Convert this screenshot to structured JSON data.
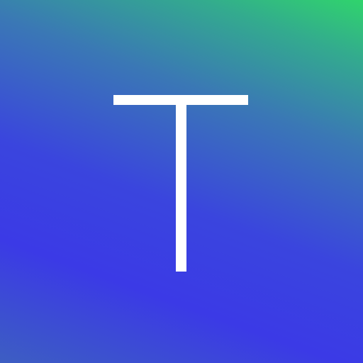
{
  "logo": {
    "letter": "T",
    "letter_color": "#ffffff",
    "gradient_colors": [
      "#3b3ae6",
      "#3a78b5",
      "#30d46c"
    ]
  }
}
